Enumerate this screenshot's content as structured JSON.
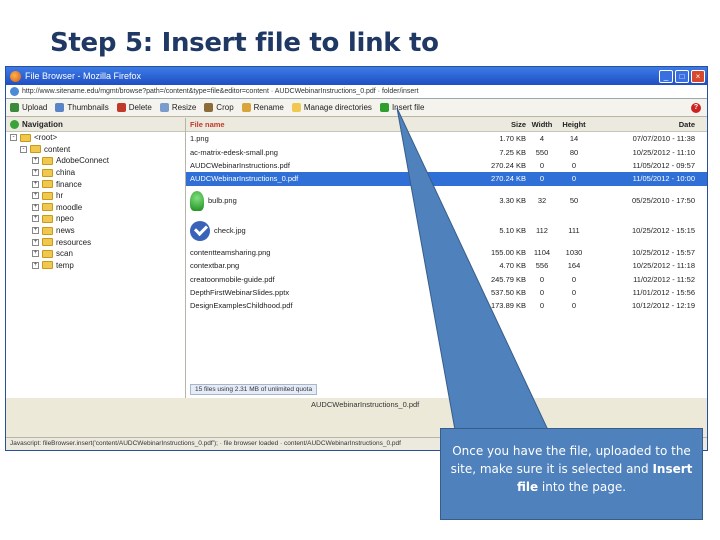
{
  "slide": {
    "title": "Step 5: Insert file to link to"
  },
  "browser": {
    "title": "File Browser - Mozilla Firefox",
    "url": "http://www.sitename.edu/mgmt/browse?path=/content&type=file&editor=content  ·  AUDCWebinarInstructions_0.pdf  ·  folder/insert",
    "status_text": "Javascript:   fileBrowser.insert('content/AUDCWebinarInstructions_0.pdf');   ·   file browser loaded   ·   content/AUDCWebinarInstructions_0.pdf"
  },
  "toolbar": {
    "upload": "Upload",
    "thumbnails": "Thumbnails",
    "delete": "Delete",
    "resize": "Resize",
    "crop": "Crop",
    "rename": "Rename",
    "manage": "Manage directories",
    "insert": "Insert file",
    "help": "?"
  },
  "nav": {
    "header": "Navigation",
    "items": [
      {
        "label": "<root>",
        "sign": "-"
      },
      {
        "label": "content",
        "sign": "-"
      },
      {
        "label": "AdobeConnect",
        "sign": "+"
      },
      {
        "label": "china",
        "sign": "+"
      },
      {
        "label": "finance",
        "sign": "+"
      },
      {
        "label": "hr",
        "sign": "+"
      },
      {
        "label": "moodle",
        "sign": "+"
      },
      {
        "label": "npeo",
        "sign": "+"
      },
      {
        "label": "news",
        "sign": "+"
      },
      {
        "label": "resources",
        "sign": "+"
      },
      {
        "label": "scan",
        "sign": "+"
      },
      {
        "label": "temp",
        "sign": "+"
      }
    ]
  },
  "files": {
    "columns": {
      "name": "File name",
      "size": "Size",
      "width": "Width",
      "height": "Height",
      "date": "Date"
    },
    "rows": [
      {
        "name": "1.png",
        "size": "1.70 KB",
        "width": "4",
        "height": "14",
        "date": "07/07/2010 - 11:38",
        "selected": false
      },
      {
        "name": "ac-matrix-edesk-small.png",
        "size": "7.25 KB",
        "width": "550",
        "height": "80",
        "date": "10/25/2012 - 11:10",
        "selected": false
      },
      {
        "name": "AUDCWebinarInstructions.pdf",
        "size": "270.24 KB",
        "width": "0",
        "height": "0",
        "date": "11/05/2012 - 09:57",
        "selected": false
      },
      {
        "name": "AUDCWebinarInstructions_0.pdf",
        "size": "270.24 KB",
        "width": "0",
        "height": "0",
        "date": "11/05/2012 - 10:00",
        "selected": true
      },
      {
        "name": "bulb.png",
        "size": "3.30 KB",
        "width": "32",
        "height": "50",
        "date": "05/25/2010 - 17:50",
        "selected": false,
        "thumb": "bulb"
      },
      {
        "name": "check.jpg",
        "size": "5.10 KB",
        "width": "112",
        "height": "111",
        "date": "10/25/2012 - 15:15",
        "selected": false,
        "thumb": "check"
      },
      {
        "name": "contentteamsharing.png",
        "size": "155.00 KB",
        "width": "1104",
        "height": "1030",
        "date": "10/25/2012 - 15:57",
        "selected": false
      },
      {
        "name": "contextbar.png",
        "size": "4.70 KB",
        "width": "556",
        "height": "164",
        "date": "10/25/2012 - 11:18",
        "selected": false
      },
      {
        "name": "creatoonmobile-guide.pdf",
        "size": "245.79 KB",
        "width": "0",
        "height": "0",
        "date": "11/02/2012 - 11:52",
        "selected": false
      },
      {
        "name": "DepthFirstWebinarSlides.pptx",
        "size": "537.50 KB",
        "width": "0",
        "height": "0",
        "date": "11/01/2012 - 15:56",
        "selected": false
      },
      {
        "name": "DesignExamplesChildhood.pdf",
        "size": "173.89 KB",
        "width": "0",
        "height": "0",
        "date": "10/12/2012 - 12:19",
        "selected": false
      }
    ],
    "status_chip": "15 files using 2.31 MB of unlimited quota",
    "selected_file": "AUDCWebinarInstructions_0.pdf"
  },
  "callout": {
    "before": "Once you have the file, uploaded to the site, make sure it is selected and ",
    "emphasis": "Insert file",
    "after": " into the page."
  },
  "colors": {
    "title": "#1f3864",
    "callout": "#4f81bd",
    "selection": "#2f6fd6"
  }
}
